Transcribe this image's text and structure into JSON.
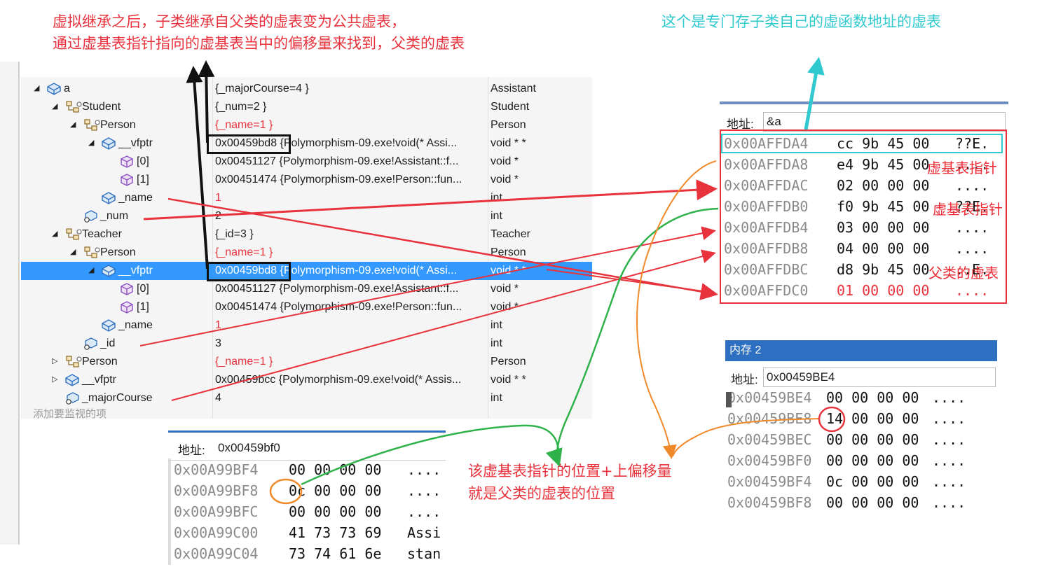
{
  "annotations": {
    "top_left_line1": "虚拟继承之后，子类继承自父类的虚表变为公共虚表，",
    "top_left_line2": "通过虚基表指针指向的虚基表当中的偏移量来找到，父类的虚表",
    "top_right": "这个是专门存子类自己的虚函数地址的虚表",
    "vbptr_label_1": "虚基表指针",
    "vbptr_label_2": "虚基表指针",
    "parent_vtable_label": "父类的虚表",
    "bottom_line1": "该虚基表指针的位置+上偏移量",
    "bottom_line2": "就是父类的虚表的位置"
  },
  "watch": {
    "add_watch_hint": "添加要监视的项",
    "rows": [
      {
        "name": "a",
        "value": "{_majorCourse=4 }",
        "type": "Assistant",
        "icon": "object-icon",
        "expand": "open"
      },
      {
        "name": "Student",
        "value": "{_num=2 }",
        "type": "Student",
        "icon": "base-class-icon",
        "expand": "open"
      },
      {
        "name": "Person",
        "value": "{_name=1 }",
        "type": "Person",
        "icon": "base-class-icon",
        "expand": "open",
        "red": true
      },
      {
        "name": "__vfptr",
        "value": "0x00459bd8 {Polymorphism-09.exe!void(* Assi...",
        "type": "void * *",
        "icon": "field-icon",
        "expand": "open"
      },
      {
        "name": "[0]",
        "value": "0x00451127 {Polymorphism-09.exe!Assistant::f...",
        "type": "void *",
        "icon": "element-icon",
        "expand": "none"
      },
      {
        "name": "[1]",
        "value": "0x00451474 {Polymorphism-09.exe!Person::fun...",
        "type": "void *",
        "icon": "element-icon",
        "expand": "none"
      },
      {
        "name": "_name",
        "value": "1",
        "type": "int",
        "icon": "field-icon",
        "expand": "none",
        "red": true
      },
      {
        "name": "_num",
        "value": "2",
        "type": "int",
        "icon": "field-alt-icon",
        "expand": "none"
      },
      {
        "name": "Teacher",
        "value": "{_id=3 }",
        "type": "Teacher",
        "icon": "base-class-icon",
        "expand": "open"
      },
      {
        "name": "Person",
        "value": "{_name=1 }",
        "type": "Person",
        "icon": "base-class-icon",
        "expand": "open",
        "red": true
      },
      {
        "name": "__vfptr",
        "value": "0x00459bd8 {Polymorphism-09.exe!void(* Assi...",
        "type": "void * *",
        "icon": "field-icon",
        "expand": "open",
        "selected": true
      },
      {
        "name": "[0]",
        "value": "0x00451127 {Polymorphism-09.exe!Assistant::f...",
        "type": "void *",
        "icon": "element-icon",
        "expand": "none"
      },
      {
        "name": "[1]",
        "value": "0x00451474 {Polymorphism-09.exe!Person::fun...",
        "type": "void *",
        "icon": "element-icon",
        "expand": "none"
      },
      {
        "name": "_name",
        "value": "1",
        "type": "int",
        "icon": "field-icon",
        "expand": "none",
        "red": true
      },
      {
        "name": "_id",
        "value": "3",
        "type": "int",
        "icon": "field-alt-icon",
        "expand": "none"
      },
      {
        "name": "Person",
        "value": "{_name=1 }",
        "type": "Person",
        "icon": "base-class-icon",
        "expand": "closed",
        "red": true
      },
      {
        "name": "__vfptr",
        "value": "0x00459bcc {Polymorphism-09.exe!void(* Assis...",
        "type": "void * *",
        "icon": "field-icon",
        "expand": "closed"
      },
      {
        "name": "_majorCourse",
        "value": "4",
        "type": "int",
        "icon": "field-alt-icon",
        "expand": "none"
      }
    ]
  },
  "memory_main": {
    "address_label": "地址:",
    "address_value": "&a",
    "rows": [
      {
        "addr": "0x00AFFDA4",
        "hex": "cc 9b 45 00",
        "ascii": "??E."
      },
      {
        "addr": "0x00AFFDA8",
        "hex": "e4 9b 45 00",
        "ascii": "...."
      },
      {
        "addr": "0x00AFFDAC",
        "hex": "02 00 00 00",
        "ascii": "...."
      },
      {
        "addr": "0x00AFFDB0",
        "hex": "f0 9b 45 00",
        "ascii": "??E."
      },
      {
        "addr": "0x00AFFDB4",
        "hex": "03 00 00 00",
        "ascii": "...."
      },
      {
        "addr": "0x00AFFDB8",
        "hex": "04 00 00 00",
        "ascii": "...."
      },
      {
        "addr": "0x00AFFDBC",
        "hex": "d8 9b 45 00",
        "ascii": "..E."
      },
      {
        "addr": "0x00AFFDC0",
        "hex": "01 00 00 00",
        "ascii": "....",
        "red": true
      }
    ]
  },
  "memory_2": {
    "title": "内存 2",
    "address_label": "地址:",
    "address_value": "0x00459BE4",
    "rows": [
      {
        "addr": "0x00459BE4",
        "hex": "00 00 00 00",
        "ascii": "...."
      },
      {
        "addr": "0x00459BE8",
        "hex": "14 00 00 00",
        "ascii": "...."
      },
      {
        "addr": "0x00459BEC",
        "hex": "00 00 00 00",
        "ascii": "...."
      },
      {
        "addr": "0x00459BF0",
        "hex": "00 00 00 00",
        "ascii": "...."
      },
      {
        "addr": "0x00459BF4",
        "hex": "0c 00 00 00",
        "ascii": "...."
      },
      {
        "addr": "0x00459BF8",
        "hex": "00 00 00 00",
        "ascii": "...."
      }
    ]
  },
  "memory_3": {
    "address_label": "地址:",
    "address_value": "0x00459bf0",
    "rows": [
      {
        "addr": "0x00A99BF4",
        "hex": "00 00 00 00",
        "ascii": "...."
      },
      {
        "addr": "0x00A99BF8",
        "hex": "0c 00 00 00",
        "ascii": "...."
      },
      {
        "addr": "0x00A99BFC",
        "hex": "00 00 00 00",
        "ascii": "...."
      },
      {
        "addr": "0x00A99C00",
        "hex": "41 73 73 69",
        "ascii": "Assi"
      },
      {
        "addr": "0x00A99C04",
        "hex": "73 74 61 6e",
        "ascii": "stan"
      }
    ]
  },
  "colors": {
    "red": "#e8323c",
    "cyan": "#2fc9cf",
    "green": "#2fb24a",
    "orange": "#f0892a",
    "selection": "#3399ff"
  }
}
